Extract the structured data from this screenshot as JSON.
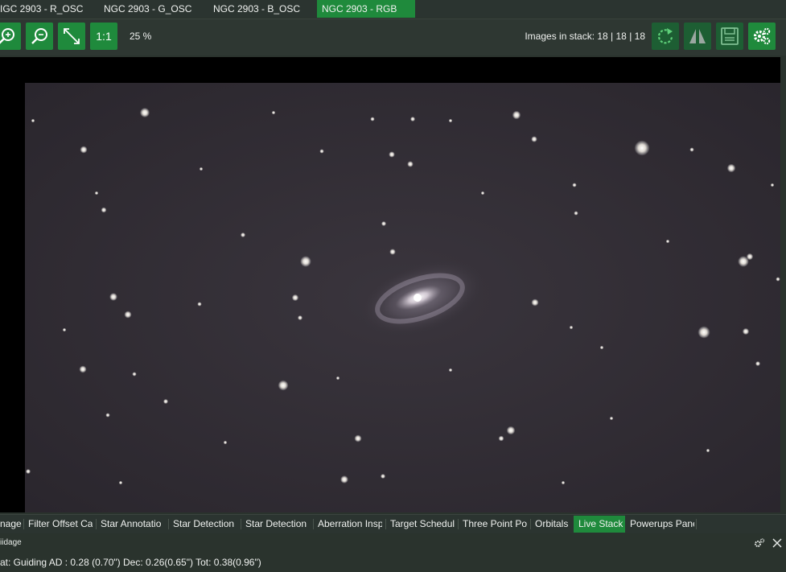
{
  "top_tabs": [
    {
      "label": "IGC 2903 - R_OSC",
      "active": false
    },
    {
      "label": "NGC 2903 - G_OSC",
      "active": false
    },
    {
      "label": "NGC 2903 - B_OSC",
      "active": false
    },
    {
      "label": "NGC 2903 - RGB",
      "active": true
    }
  ],
  "toolbar": {
    "zoom_in_icon": "zoom-in-icon",
    "zoom_out_icon": "zoom-out-icon",
    "fit_icon": "fit-to-window-icon",
    "one_to_one_label": "1:1",
    "zoom_level": "25 %",
    "stack_info": "Images in stack: 18 | 18 | 18",
    "right_icons": [
      "refresh-icon",
      "flip-icon",
      "save-icon",
      "settings-icon"
    ]
  },
  "viewer": {
    "object": "NGC 2903",
    "background_color": "#28252a"
  },
  "bottom_tabs": [
    {
      "label": "nage",
      "active": false
    },
    {
      "label": "Filter Offset Ca",
      "active": false
    },
    {
      "label": "Star Annotatio",
      "active": false
    },
    {
      "label": "Star Detection",
      "active": false
    },
    {
      "label": "Star Detection",
      "active": false
    },
    {
      "label": "Aberration Insp",
      "active": false
    },
    {
      "label": "Target Schedul",
      "active": false
    },
    {
      "label": "Three Point Po",
      "active": false
    },
    {
      "label": "Orbitals",
      "active": false
    },
    {
      "label": "Live Stack",
      "active": true
    },
    {
      "label": "Powerups Pane",
      "active": false
    }
  ],
  "panel": {
    "title": "iidage",
    "status": "at: Guiding  AD : 0.28 (0.70\")  Dec: 0.26(0.65\")  Tot: 0.38(0.96\")"
  },
  "colors": {
    "accent": "#1f8a3c",
    "background": "#2a332d",
    "text": "#f0f2f0"
  }
}
